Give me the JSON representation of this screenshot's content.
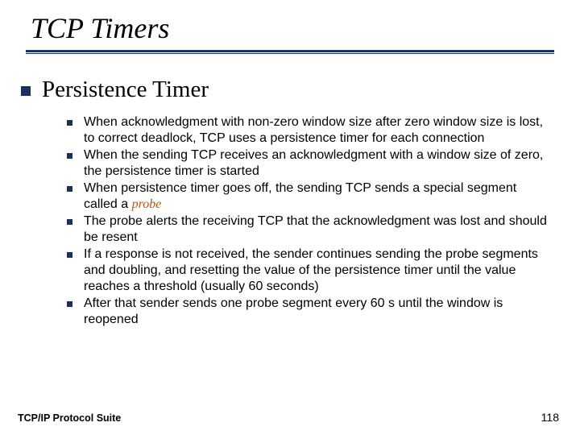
{
  "title": "TCP Timers",
  "topic": "Persistence Timer",
  "points": [
    {
      "text": "When acknowledgment with non-zero window size after zero window size is lost,  to correct deadlock, TCP uses a persistence timer for each connection"
    },
    {
      "text": "When the sending TCP receives an acknowledgment with a window size of zero, the persistence timer is started"
    },
    {
      "pre": "When persistence timer goes off, the sending TCP sends a special segment called a ",
      "em": "probe"
    },
    {
      "text": "The probe alerts the receiving TCP that the acknowledgment was lost and should be resent"
    },
    {
      "text": "If a response is not received, the sender continues sending the probe segments and doubling, and resetting the value of the persistence timer until the value reaches a threshold (usually 60 seconds)"
    },
    {
      "text": "After that sender sends one probe segment every 60 s until the window is reopened"
    }
  ],
  "footer_left": "TCP/IP Protocol Suite",
  "footer_right": "118"
}
